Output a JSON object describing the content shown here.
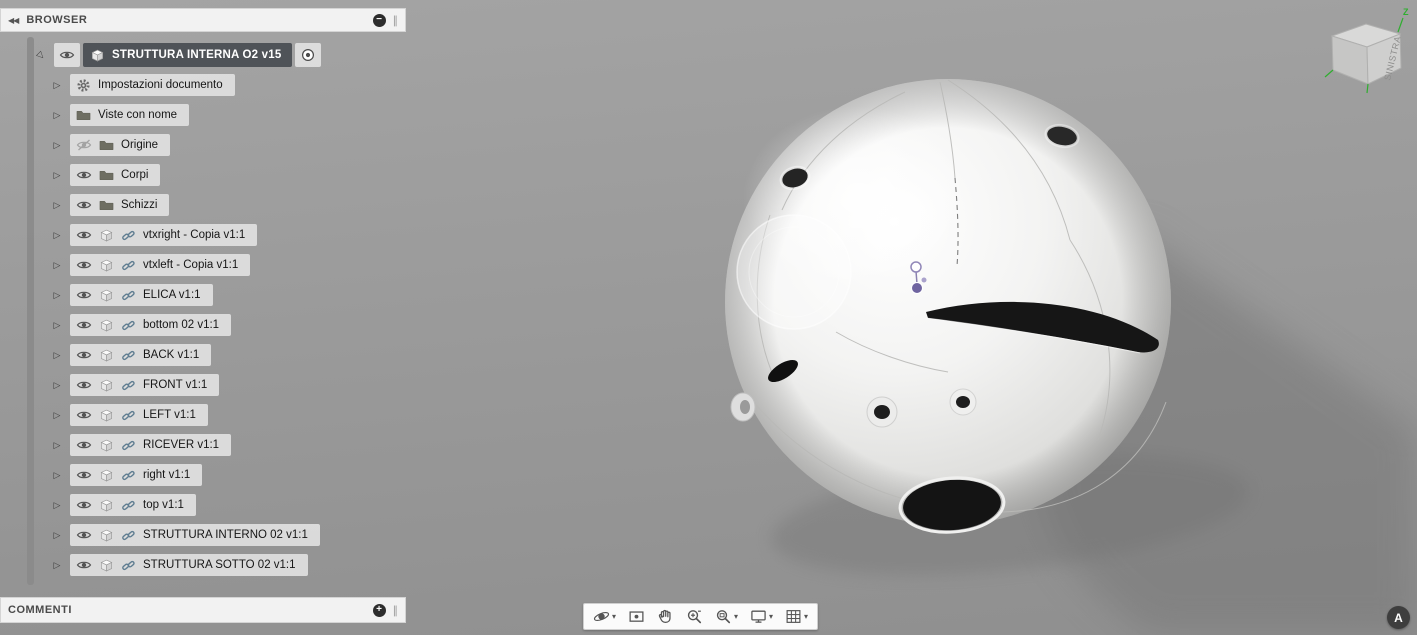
{
  "browser": {
    "title": "BROWSER",
    "root": {
      "label": "STRUTTURA INTERNA O2 v15",
      "eye": "on",
      "icon": "component"
    },
    "items": [
      {
        "label": "Impostazioni documento",
        "icon": "gear",
        "eye": "none",
        "link": false
      },
      {
        "label": "Viste con nome",
        "icon": "folder",
        "eye": "none",
        "link": false
      },
      {
        "label": "Origine",
        "icon": "folder",
        "eye": "off",
        "link": false
      },
      {
        "label": "Corpi",
        "icon": "folder",
        "eye": "on",
        "link": false
      },
      {
        "label": "Schizzi",
        "icon": "folder",
        "eye": "on",
        "link": false
      },
      {
        "label": "vtxright - Copia v1:1",
        "icon": "component",
        "eye": "on",
        "link": true
      },
      {
        "label": "vtxleft - Copia v1:1",
        "icon": "component",
        "eye": "on",
        "link": true
      },
      {
        "label": "ELICA v1:1",
        "icon": "component",
        "eye": "on",
        "link": true
      },
      {
        "label": "bottom 02 v1:1",
        "icon": "component",
        "eye": "on",
        "link": true
      },
      {
        "label": "BACK v1:1",
        "icon": "component",
        "eye": "on",
        "link": true
      },
      {
        "label": "FRONT v1:1",
        "icon": "component",
        "eye": "on",
        "link": true
      },
      {
        "label": "LEFT v1:1",
        "icon": "component",
        "eye": "on",
        "link": true
      },
      {
        "label": "RICEVER v1:1",
        "icon": "component",
        "eye": "on",
        "link": true
      },
      {
        "label": "right v1:1",
        "icon": "component",
        "eye": "on",
        "link": true
      },
      {
        "label": "top v1:1",
        "icon": "component",
        "eye": "on",
        "link": true
      },
      {
        "label": "STRUTTURA INTERNO 02 v1:1",
        "icon": "component",
        "eye": "on",
        "link": true
      },
      {
        "label": "STRUTTURA SOTTO 02 v1:1",
        "icon": "component",
        "eye": "on",
        "link": true
      }
    ]
  },
  "comments": {
    "title": "COMMENTI"
  },
  "viewcube": {
    "face_label": "SINISTRA",
    "axis_label": "Z"
  },
  "nav_toolbar": [
    {
      "name": "orbit",
      "caret": true
    },
    {
      "name": "look-at",
      "caret": false
    },
    {
      "name": "pan",
      "caret": false
    },
    {
      "name": "zoom",
      "caret": false
    },
    {
      "name": "fit",
      "caret": true
    },
    {
      "name": "display",
      "caret": true
    },
    {
      "name": "grid",
      "caret": true
    }
  ],
  "assistant": {
    "label": "A"
  },
  "icons": {
    "collapse": "◀◀",
    "minimize": "−",
    "add": "+",
    "grip": "∥",
    "caret": "▾",
    "disclosure": "▷"
  },
  "colors": {
    "canvas_top": "#a4a4a4",
    "canvas_bottom": "#8f8f8f",
    "selection_dark": "#4f5358",
    "axis_green": "#2fae2f",
    "marker_purple": "#6f64a0"
  }
}
